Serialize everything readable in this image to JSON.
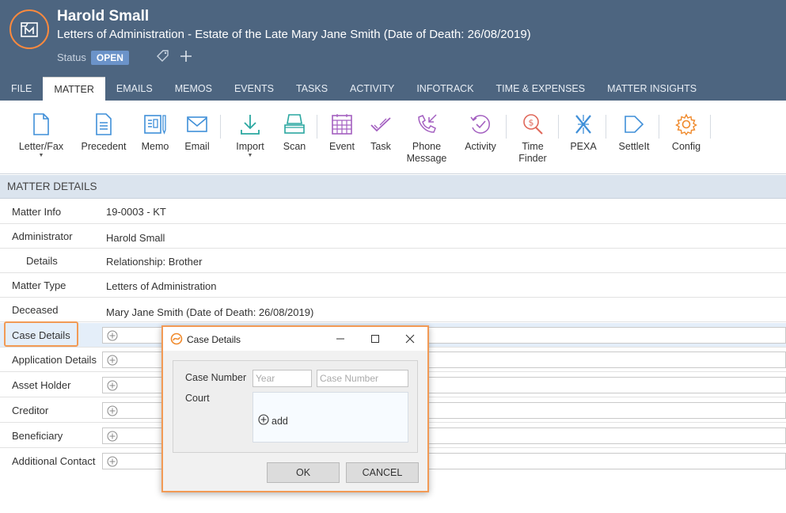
{
  "header": {
    "client_name": "Harold Small",
    "matter_title": "Letters of Administration - Estate of the Late Mary Jane Smith (Date of Death: 26/08/2019)",
    "status_label": "Status",
    "status_value": "OPEN"
  },
  "tabs": [
    {
      "label": "FILE",
      "active": false
    },
    {
      "label": "MATTER",
      "active": true
    },
    {
      "label": "EMAILS",
      "active": false
    },
    {
      "label": "MEMOS",
      "active": false
    },
    {
      "label": "EVENTS",
      "active": false
    },
    {
      "label": "TASKS",
      "active": false
    },
    {
      "label": "ACTIVITY",
      "active": false
    },
    {
      "label": "INFOTRACK",
      "active": false
    },
    {
      "label": "TIME & EXPENSES",
      "active": false
    },
    {
      "label": "MATTER INSIGHTS",
      "active": false
    }
  ],
  "ribbon": {
    "letter_fax": "Letter/Fax",
    "precedent": "Precedent",
    "memo": "Memo",
    "email": "Email",
    "import": "Import",
    "scan": "Scan",
    "event": "Event",
    "task": "Task",
    "phone_message_1": "Phone",
    "phone_message_2": "Message",
    "activity": "Activity",
    "time_finder_1": "Time",
    "time_finder_2": "Finder",
    "pexa": "PEXA",
    "settleit": "SettleIt",
    "config": "Config"
  },
  "section": {
    "title": "MATTER DETAILS"
  },
  "details": {
    "matter_info_label": "Matter Info",
    "matter_info_value": "19-0003 - KT",
    "administrator_label": "Administrator",
    "administrator_value": "Harold Small",
    "details_label": "Details",
    "details_value": "Relationship: Brother",
    "matter_type_label": "Matter Type",
    "matter_type_value": "Letters of Administration",
    "deceased_label": "Deceased",
    "deceased_value": "Mary Jane Smith (Date of Death: 26/08/2019)",
    "case_details_label": "Case Details",
    "application_details_label": "Application Details",
    "asset_holder_label": "Asset Holder",
    "creditor_label": "Creditor",
    "beneficiary_label": "Beneficiary",
    "additional_contact_label": "Additional Contact"
  },
  "dialog": {
    "title": "Case Details",
    "case_number_label": "Case Number",
    "year_placeholder": "Year",
    "case_number_placeholder": "Case Number",
    "court_label": "Court",
    "add_label": "add",
    "ok_label": "OK",
    "cancel_label": "CANCEL"
  },
  "colors": {
    "header_bg": "#4d6580",
    "accent_orange": "#f29a55",
    "status_badge": "#6b93c9",
    "icon_blue": "#3f8fd8",
    "icon_teal": "#2aa7a0",
    "icon_purple": "#a35fc0",
    "icon_red": "#e0685a",
    "icon_orange": "#f08a2c"
  }
}
